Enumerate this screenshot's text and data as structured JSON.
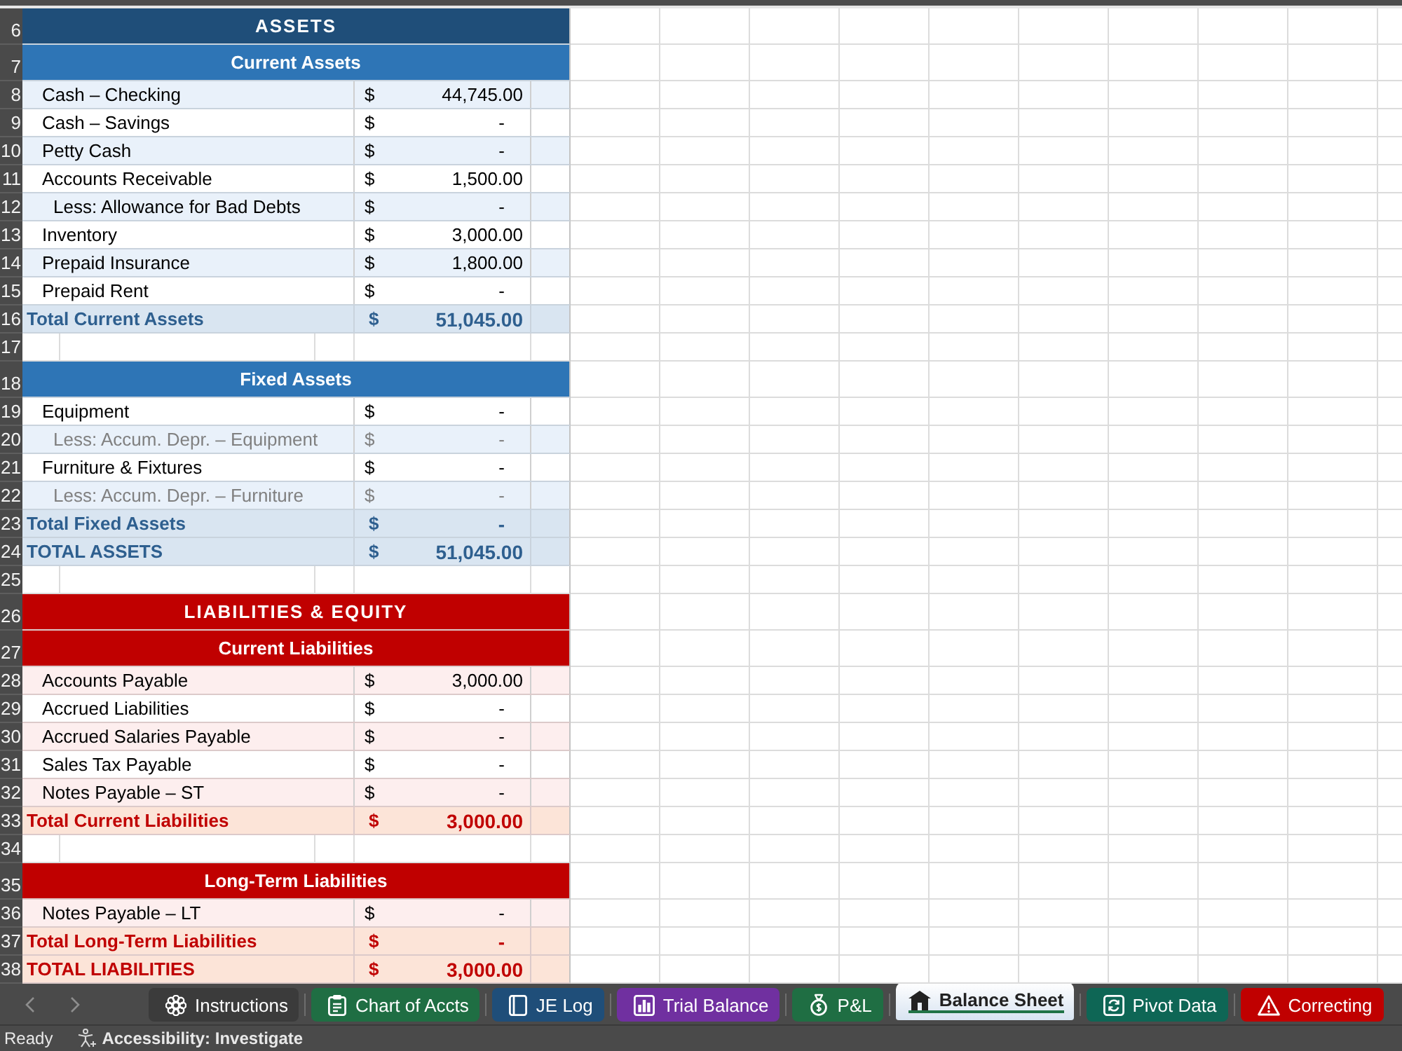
{
  "sheet": {
    "row_numbers": [
      "6",
      "7",
      "8",
      "9",
      "10",
      "11",
      "12",
      "13",
      "14",
      "15",
      "16",
      "17",
      "18",
      "19",
      "20",
      "21",
      "22",
      "23",
      "24",
      "25",
      "26",
      "27",
      "28",
      "29",
      "30",
      "31",
      "32",
      "33",
      "34",
      "35",
      "36",
      "37",
      "38"
    ],
    "parts": [
      {
        "kind": "assets",
        "title": "ASSETS",
        "groups": [
          {
            "heading": "Current Assets",
            "lines": [
              {
                "label": "Cash – Checking",
                "currency": "$",
                "amount": "44,745.00"
              },
              {
                "label": "Cash – Savings",
                "currency": "$",
                "amount": "-"
              },
              {
                "label": "Petty Cash",
                "currency": "$",
                "amount": "-"
              },
              {
                "label": "Accounts Receivable",
                "currency": "$",
                "amount": "1,500.00",
                "children": [
                  {
                    "label": "Less: Allowance for Bad Debts",
                    "currency": "$",
                    "amount": "-",
                    "dimmed": false
                  }
                ]
              },
              {
                "label": "Inventory",
                "currency": "$",
                "amount": "3,000.00"
              },
              {
                "label": "Prepaid Insurance",
                "currency": "$",
                "amount": "1,800.00"
              },
              {
                "label": "Prepaid Rent",
                "currency": "$",
                "amount": "-"
              }
            ],
            "total": {
              "label": "Total Current Assets",
              "currency": "$",
              "amount": "51,045.00"
            }
          },
          {
            "heading": "Fixed Assets",
            "lines": [
              {
                "label": "Equipment",
                "currency": "$",
                "amount": "-",
                "children": [
                  {
                    "label": "Less: Accum. Depr. – Equipment",
                    "currency": "$",
                    "amount": "-",
                    "dimmed": true
                  }
                ]
              },
              {
                "label": "Furniture & Fixtures",
                "currency": "$",
                "amount": "-",
                "children": [
                  {
                    "label": "Less: Accum. Depr. – Furniture",
                    "currency": "$",
                    "amount": "-",
                    "dimmed": true
                  }
                ]
              }
            ],
            "total": {
              "label": "Total Fixed Assets",
              "currency": "$",
              "amount": "-"
            }
          }
        ],
        "grand_total": {
          "label": "TOTAL ASSETS",
          "currency": "$",
          "amount": "51,045.00"
        }
      },
      {
        "kind": "liabilities",
        "title": "LIABILITIES & EQUITY",
        "groups": [
          {
            "heading": "Current Liabilities",
            "lines": [
              {
                "label": "Accounts Payable",
                "currency": "$",
                "amount": "3,000.00"
              },
              {
                "label": "Accrued Liabilities",
                "currency": "$",
                "amount": "-"
              },
              {
                "label": "Accrued Salaries Payable",
                "currency": "$",
                "amount": "-"
              },
              {
                "label": "Sales Tax Payable",
                "currency": "$",
                "amount": "-"
              },
              {
                "label": "Notes Payable – ST",
                "currency": "$",
                "amount": "-"
              }
            ],
            "total": {
              "label": "Total Current Liabilities",
              "currency": "$",
              "amount": "3,000.00"
            }
          },
          {
            "heading": "Long-Term Liabilities",
            "lines": [
              {
                "label": "Notes Payable – LT",
                "currency": "$",
                "amount": "-"
              }
            ],
            "total": {
              "label": "Total Long-Term Liabilities",
              "currency": "$",
              "amount": "-"
            }
          }
        ],
        "grand_total": {
          "label": "TOTAL LIABILITIES",
          "currency": "$",
          "amount": "3,000.00"
        }
      }
    ]
  },
  "sheet_tabs": [
    {
      "label": "Instructions",
      "color": "#3b3b3b",
      "selected": false
    },
    {
      "label": "Chart of Accts",
      "color": "#1f6e43",
      "selected": false
    },
    {
      "label": "JE Log",
      "color": "#1f4e79",
      "selected": false
    },
    {
      "label": "Trial Balance",
      "color": "#7030a0",
      "selected": false
    },
    {
      "label": "P&L",
      "color": "#1f6e43",
      "selected": false
    },
    {
      "label": "Balance Sheet",
      "color": "#217346",
      "selected": true
    },
    {
      "label": "Pivot Data",
      "color": "#0e6655",
      "selected": false
    },
    {
      "label": "Correcting",
      "color": "#c00000",
      "selected": false
    }
  ],
  "status_bar": {
    "mode": "Ready",
    "accessibility": "Accessibility: Investigate"
  }
}
